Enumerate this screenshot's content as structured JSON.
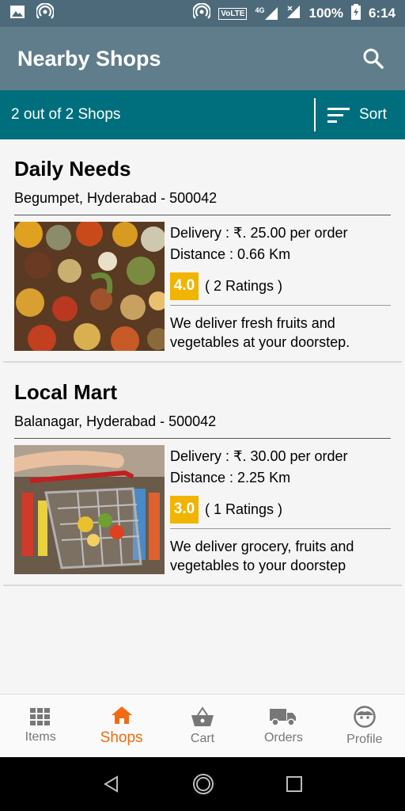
{
  "status_bar": {
    "battery": "100%",
    "time": "6:14",
    "network_label": "VoLTE",
    "signal_label": "4G"
  },
  "header": {
    "title": "Nearby Shops",
    "search_icon": "search-icon"
  },
  "filter_bar": {
    "count_text": "2 out of 2 Shops",
    "sort_label": "Sort"
  },
  "shops": [
    {
      "name": "Daily Needs",
      "address": "Begumpet, Hyderabad - 500042",
      "delivery": "Delivery : ₹. 25.00 per order",
      "distance": "Distance : 0.66 Km",
      "rating": "4.0",
      "ratings_count": "( 2 Ratings )",
      "description": "We deliver fresh fruits and vegetables at your doorstep.",
      "image": "spices-image"
    },
    {
      "name": "Local Mart",
      "address": "Balanagar, Hyderabad - 500042",
      "delivery": "Delivery : ₹. 30.00 per order",
      "distance": "Distance : 2.25 Km",
      "rating": "3.0",
      "ratings_count": "( 1 Ratings )",
      "description": "We deliver grocery, fruits and vegetables to your doorstep",
      "image": "shopping-cart-image"
    }
  ],
  "bottom_nav": {
    "items": [
      {
        "label": "Items",
        "icon": "grid-icon"
      },
      {
        "label": "Shops",
        "icon": "home-icon",
        "active": true
      },
      {
        "label": "Cart",
        "icon": "basket-icon"
      },
      {
        "label": "Orders",
        "icon": "truck-icon"
      },
      {
        "label": "Profile",
        "icon": "face-icon"
      }
    ]
  },
  "colors": {
    "status_bar": "#4d6a7a",
    "app_bar": "#607d8b",
    "filter_bar": "#006f7d",
    "rating_badge": "#f1b400",
    "active_nav": "#f26b10"
  }
}
